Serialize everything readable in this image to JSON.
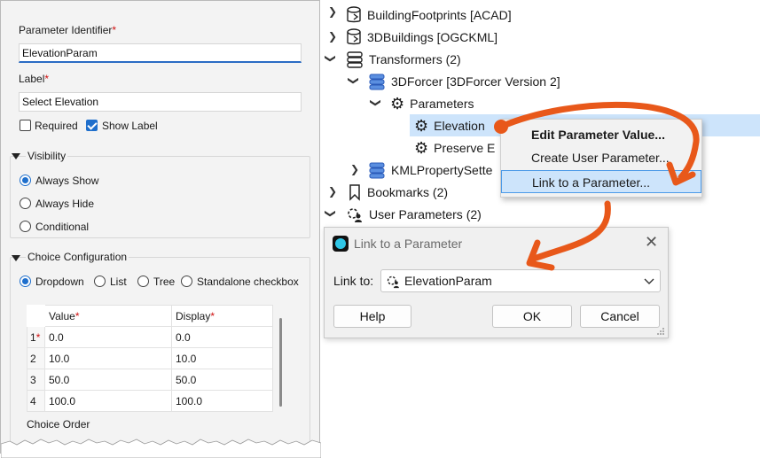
{
  "left_panel": {
    "param_identifier_label": "Parameter Identifier",
    "param_identifier_value": "ElevationParam",
    "label_label": "Label",
    "label_value": "Select Elevation",
    "required_mark": "*",
    "required_label": "Required",
    "required_checked": false,
    "show_label_label": "Show Label",
    "show_label_checked": true,
    "visibility": {
      "title": "Visibility",
      "options": [
        "Always Show",
        "Always Hide",
        "Conditional"
      ],
      "selected": "Always Show"
    },
    "choice_config": {
      "title": "Choice Configuration",
      "options": [
        "Dropdown",
        "List",
        "Tree",
        "Standalone checkbox"
      ],
      "selected": "Dropdown",
      "table": {
        "columns": [
          "Value",
          "Display"
        ],
        "rows": [
          {
            "num": "1",
            "value": "0.0",
            "display": "0.0"
          },
          {
            "num": "2",
            "value": "10.0",
            "display": "10.0"
          },
          {
            "num": "3",
            "value": "50.0",
            "display": "50.0"
          },
          {
            "num": "4",
            "value": "100.0",
            "display": "100.0"
          }
        ]
      },
      "choice_order_label": "Choice Order"
    }
  },
  "tree": {
    "items": [
      {
        "label": "BuildingFootprints [ACAD]",
        "icon": "database-reader-icon"
      },
      {
        "label": "3DBuildings [OGCKML]",
        "icon": "database-reader-icon"
      },
      {
        "label": "Transformers (2)",
        "icon": "database-stack-icon"
      },
      {
        "label": "3DForcer [3DForcer Version 2]",
        "icon": "transformer-icon"
      },
      {
        "label": "Parameters",
        "icon": "gear-icon"
      },
      {
        "label": "Elevation",
        "icon": "gear-icon"
      },
      {
        "label": "Preserve E",
        "icon": "gear-icon"
      },
      {
        "label": "KMLPropertySette",
        "icon": "transformer-icon"
      },
      {
        "label": "Bookmarks (2)",
        "icon": "bookmark-icon"
      },
      {
        "label": "User Parameters (2)",
        "icon": "user-parameters-icon"
      }
    ]
  },
  "context_menu": {
    "items": [
      "Edit Parameter Value...",
      "Create User Parameter...",
      "Link to a Parameter..."
    ],
    "active": "Link to a Parameter..."
  },
  "dialog": {
    "title": "Link to a Parameter",
    "link_to_label": "Link to:",
    "link_to_value": "ElevationParam",
    "help_button": "Help",
    "ok_button": "OK",
    "cancel_button": "Cancel"
  },
  "colors": {
    "accent": "#1f6fcc",
    "highlight": "#cde4fb",
    "annotation_arrow": "#e8581a",
    "required": "#d01010"
  }
}
